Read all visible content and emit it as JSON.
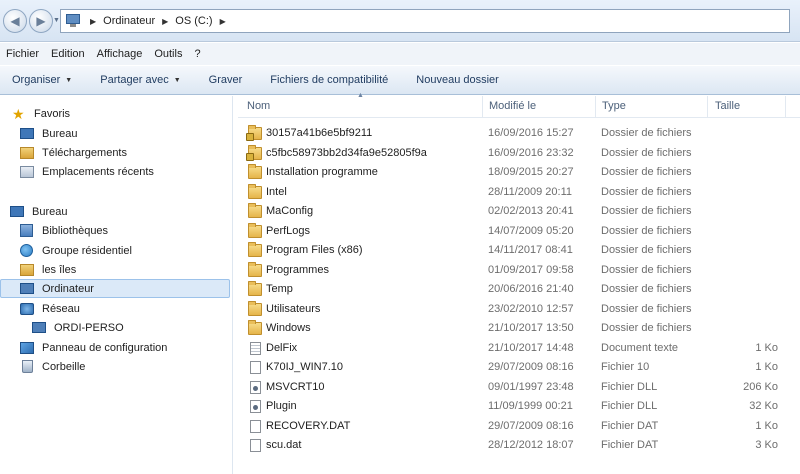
{
  "address": {
    "crumbs": [
      "Ordinateur",
      "OS (C:)"
    ]
  },
  "menu": [
    "Fichier",
    "Edition",
    "Affichage",
    "Outils",
    "?"
  ],
  "toolbar": {
    "organize": "Organiser",
    "share": "Partager avec",
    "burn": "Graver",
    "compat": "Fichiers de compatibilité",
    "new_folder": "Nouveau dossier"
  },
  "sidebar": {
    "items": [
      {
        "label": "Favoris",
        "icon": "star-icon"
      },
      {
        "label": "Bureau",
        "icon": "desktop-icon"
      },
      {
        "label": "Téléchargements",
        "icon": "downloads-icon"
      },
      {
        "label": "Emplacements récents",
        "icon": "recent-places-icon"
      },
      {
        "label": "Bureau",
        "icon": "desktop-icon"
      },
      {
        "label": "Bibliothèques",
        "icon": "libraries-icon"
      },
      {
        "label": "Groupe résidentiel",
        "icon": "homegroup-icon"
      },
      {
        "label": "les îles",
        "icon": "user-folder-icon"
      },
      {
        "label": "Ordinateur",
        "icon": "computer-icon"
      },
      {
        "label": "Réseau",
        "icon": "network-icon"
      },
      {
        "label": "ORDI-PERSO",
        "icon": "network-computer-icon"
      },
      {
        "label": "Panneau de configuration",
        "icon": "control-panel-icon"
      },
      {
        "label": "Corbeille",
        "icon": "recycle-bin-icon"
      }
    ],
    "selected": "Ordinateur"
  },
  "columns": {
    "name": "Nom",
    "modified": "Modifié le",
    "type": "Type",
    "size": "Taille"
  },
  "files": [
    {
      "name": "30157a41b6e5bf9211",
      "modified": "16/09/2016 15:27",
      "type": "Dossier de fichiers",
      "size": "",
      "icon": "locked-folder-icon"
    },
    {
      "name": "c5fbc58973bb2d34fa9e52805f9a",
      "modified": "16/09/2016 23:32",
      "type": "Dossier de fichiers",
      "size": "",
      "icon": "locked-folder-icon"
    },
    {
      "name": "Installation programme",
      "modified": "18/09/2015 20:27",
      "type": "Dossier de fichiers",
      "size": "",
      "icon": "folder-icon"
    },
    {
      "name": "Intel",
      "modified": "28/11/2009 20:11",
      "type": "Dossier de fichiers",
      "size": "",
      "icon": "folder-icon"
    },
    {
      "name": "MaConfig",
      "modified": "02/02/2013 20:41",
      "type": "Dossier de fichiers",
      "size": "",
      "icon": "folder-icon"
    },
    {
      "name": "PerfLogs",
      "modified": "14/07/2009 05:20",
      "type": "Dossier de fichiers",
      "size": "",
      "icon": "folder-icon"
    },
    {
      "name": "Program Files (x86)",
      "modified": "14/11/2017 08:41",
      "type": "Dossier de fichiers",
      "size": "",
      "icon": "folder-icon"
    },
    {
      "name": "Programmes",
      "modified": "01/09/2017 09:58",
      "type": "Dossier de fichiers",
      "size": "",
      "icon": "folder-icon"
    },
    {
      "name": "Temp",
      "modified": "20/06/2016 21:40",
      "type": "Dossier de fichiers",
      "size": "",
      "icon": "folder-icon"
    },
    {
      "name": "Utilisateurs",
      "modified": "23/02/2010 12:57",
      "type": "Dossier de fichiers",
      "size": "",
      "icon": "folder-icon"
    },
    {
      "name": "Windows",
      "modified": "21/10/2017 13:50",
      "type": "Dossier de fichiers",
      "size": "",
      "icon": "folder-icon"
    },
    {
      "name": "DelFix",
      "modified": "21/10/2017 14:48",
      "type": "Document texte",
      "size": "1 Ko",
      "icon": "text-file-icon"
    },
    {
      "name": "K70IJ_WIN7.10",
      "modified": "29/07/2009 08:16",
      "type": "Fichier 10",
      "size": "1 Ko",
      "icon": "file-icon"
    },
    {
      "name": "MSVCRT10",
      "modified": "09/01/1997 23:48",
      "type": "Fichier DLL",
      "size": "206 Ko",
      "icon": "dll-file-icon"
    },
    {
      "name": "Plugin",
      "modified": "11/09/1999 00:21",
      "type": "Fichier DLL",
      "size": "32 Ko",
      "icon": "dll-file-icon"
    },
    {
      "name": "RECOVERY.DAT",
      "modified": "29/07/2009 08:16",
      "type": "Fichier DAT",
      "size": "1 Ko",
      "icon": "file-icon"
    },
    {
      "name": "scu.dat",
      "modified": "28/12/2012 18:07",
      "type": "Fichier DAT",
      "size": "3 Ko",
      "icon": "file-icon"
    }
  ]
}
